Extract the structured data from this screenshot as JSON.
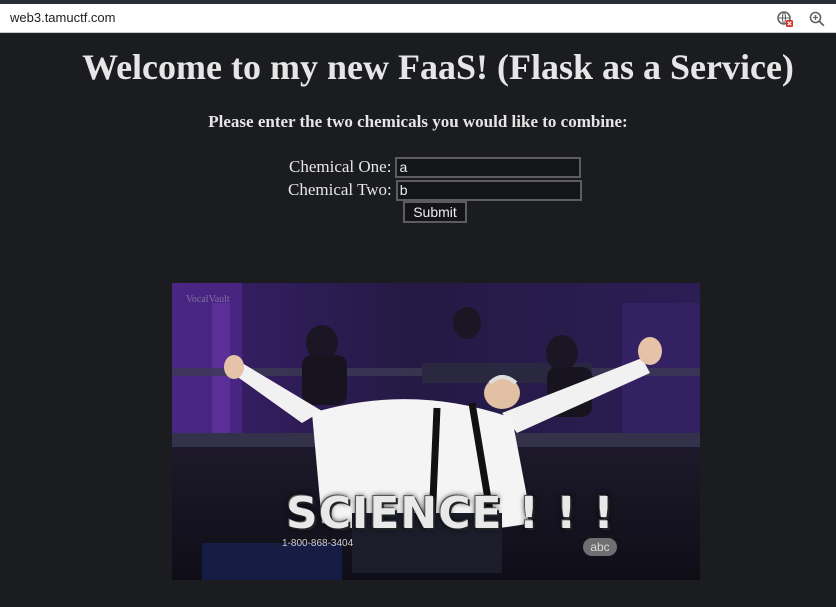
{
  "browser": {
    "url": "web3.tamuctf.com",
    "icons": [
      "extension-blocked-icon",
      "zoom-icon"
    ]
  },
  "page": {
    "title": "Welcome to my new FaaS! (Flask as a Service)",
    "prompt": "Please enter the two chemicals you would like to combine:",
    "form": {
      "chemical_one_label": "Chemical One:",
      "chemical_one_value": "a",
      "chemical_two_label": "Chemical Two:",
      "chemical_two_value": "b",
      "submit_label": "Submit"
    },
    "image": {
      "caption": "SCIENCE ! ! !",
      "phone": "1-800-868-3404",
      "watermark": "VocalVault",
      "logo_text": "abc"
    }
  },
  "colors": {
    "background": "#1b1c20",
    "text": "#e6e6e6",
    "input_background": "#141518",
    "input_border": "#5d5d5d"
  }
}
